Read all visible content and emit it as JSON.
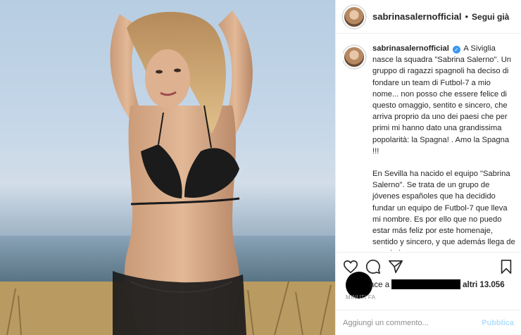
{
  "post": {
    "photo_icon": "woman-in-black-bikini-photo"
  },
  "header": {
    "username": "sabrinasalernofficial",
    "separator": "•",
    "follow_label": "Segui già"
  },
  "caption": {
    "username": "sabrinasalernofficial",
    "verified_icon": "verified-badge-icon",
    "paragraph_1": "A Siviglia nasce la squadra \"Sabrina Salerno\". Un gruppo di ragazzi spagnoli ha deciso di fondare un team di Futbol-7 a mio nome... non posso che essere felice di questo omaggio, sentito e sincero, che arriva proprio da uno dei paesi che per primi mi hanno dato una grandissima popolarità: la Spagna! . Amo la Spagna !!!",
    "paragraph_2": "En Sevilla ha nacido el equipo \"Sabrina Salerno\". Se trata de un grupo de jóvenes españoles que ha decidido fundar un equipo de Futbol-7 que lleva mi nombre. Es por ello que no puedo estar más feliz por este homenaje, sentido y sincero, y que además llega de uno de los"
  },
  "actions": {
    "like_icon": "heart-icon",
    "comment_icon": "comment-bubble-icon",
    "share_icon": "paper-plane-icon",
    "save_icon": "bookmark-icon"
  },
  "likes": {
    "prefix": "ace a",
    "suffix": "altri 13.056"
  },
  "timestamp": "MINUTI FA",
  "comment_box": {
    "placeholder": "Aggiungi un commento...",
    "publish_label": "Pubblica"
  },
  "colors": {
    "verified": "#3897f0",
    "publish_disabled": "#b2dffc",
    "muted": "#8e8e8e"
  }
}
